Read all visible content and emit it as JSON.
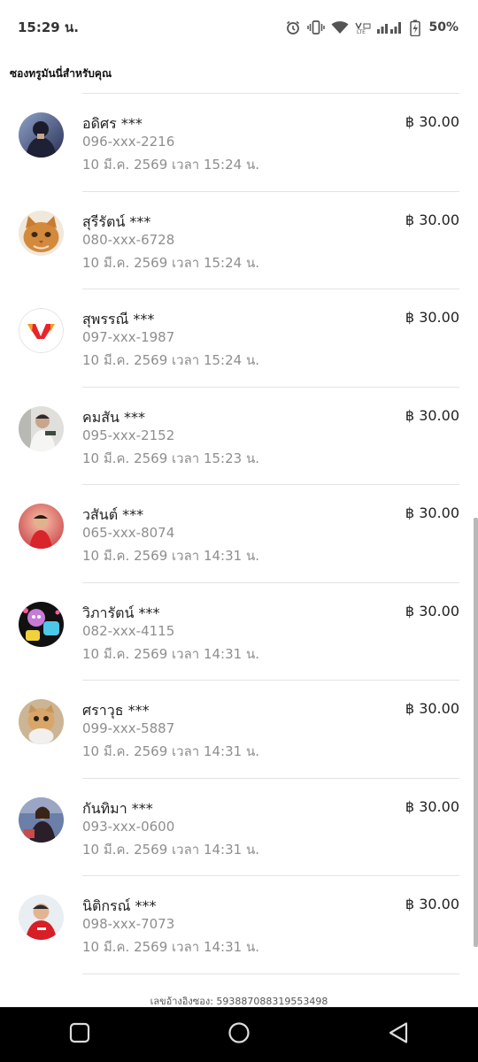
{
  "status_bar": {
    "time": "15:29 น.",
    "battery": "50%",
    "icons": [
      "alarm-icon",
      "vibrate-icon",
      "wifi-icon",
      "volte-icon",
      "signal-icon",
      "battery-charging-icon"
    ]
  },
  "section_title": "ซองทรูมันนี่สำหรับคุณ",
  "recipients": [
    {
      "name": "อดิศร ***",
      "phone": "096-xxx-2216",
      "date": "10 มี.ค. 2569 เวลา 15:24 น.",
      "amount": "฿ 30.00",
      "avatar": "avatar-dark-figure"
    },
    {
      "name": "สุรีรัตน์ ***",
      "phone": "080-xxx-6728",
      "date": "10 มี.ค. 2569 เวลา 15:24 น.",
      "amount": "฿ 30.00",
      "avatar": "avatar-cat-orange"
    },
    {
      "name": "สุพรรณี ***",
      "phone": "097-xxx-1987",
      "date": "10 มี.ค. 2569 เวลา 15:24 น.",
      "amount": "฿ 30.00",
      "avatar": "avatar-w-logo"
    },
    {
      "name": "คมสัน ***",
      "phone": "095-xxx-2152",
      "date": "10 มี.ค. 2569 เวลา 15:23 น.",
      "amount": "฿ 30.00",
      "avatar": "avatar-person-light"
    },
    {
      "name": "วสันต์ ***",
      "phone": "065-xxx-8074",
      "date": "10 มี.ค. 2569 เวลา 14:31 น.",
      "amount": "฿ 30.00",
      "avatar": "avatar-child-red"
    },
    {
      "name": "วิภารัตน์ ***",
      "phone": "082-xxx-4115",
      "date": "10 มี.ค. 2569 เวลา 14:31 น.",
      "amount": "฿ 30.00",
      "avatar": "avatar-cartoon"
    },
    {
      "name": "ศราวุธ ***",
      "phone": "099-xxx-5887",
      "date": "10 มี.ค. 2569 เวลา 14:31 น.",
      "amount": "฿ 30.00",
      "avatar": "avatar-cat-tan"
    },
    {
      "name": "กันทิมา ***",
      "phone": "093-xxx-0600",
      "date": "10 มี.ค. 2569 เวลา 14:31 น.",
      "amount": "฿ 30.00",
      "avatar": "avatar-person-dark"
    },
    {
      "name": "นิติกรณ์ ***",
      "phone": "098-xxx-7073",
      "date": "10 มี.ค. 2569 เวลา 14:31 น.",
      "amount": "฿ 30.00",
      "avatar": "avatar-man-red-shirt"
    }
  ],
  "reference": "เลขอ้างอิงซอง: 593887088319553498",
  "nav": {
    "icons": [
      "recent-apps-icon",
      "home-icon",
      "back-icon"
    ]
  }
}
